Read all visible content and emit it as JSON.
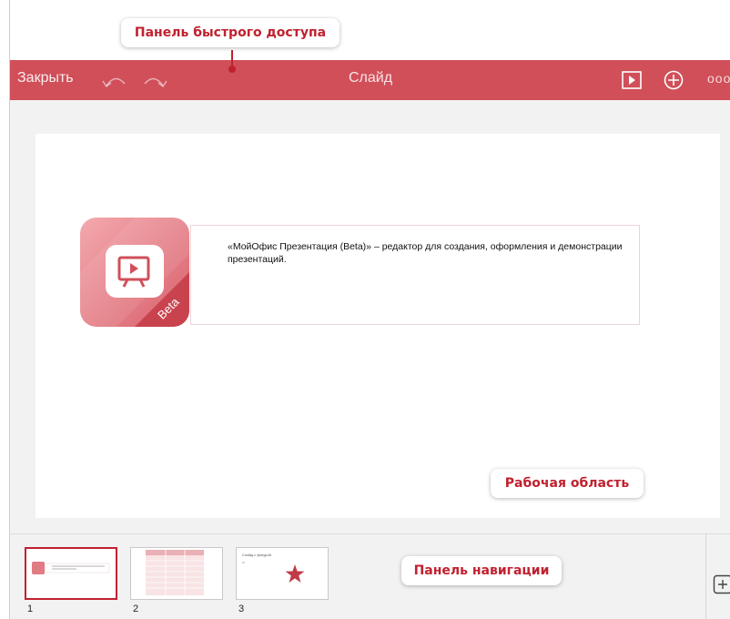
{
  "toolbar": {
    "close_label": "Закрыть",
    "title": "Слайд",
    "more_label": "ooo",
    "undo_icon": "undo-icon",
    "redo_icon": "redo-icon",
    "play_icon": "play-icon",
    "add_icon": "plus-circle-icon",
    "bg_color": "#d04f59"
  },
  "annotations": {
    "quick_access": "Панель быстрого доступа",
    "work_area": "Рабочая область",
    "navigation": "Панель навигации",
    "color": "#c0212f"
  },
  "slide": {
    "text": "«МойОфис Презентация (Beta)»  – редактор для создания, оформления и демонстрации презентаций.",
    "logo_badge": "Beta"
  },
  "navigation": {
    "thumbnails": [
      {
        "number": "1",
        "selected": true
      },
      {
        "number": "2",
        "selected": false
      },
      {
        "number": "3",
        "selected": false
      }
    ],
    "thumb3_title": "Слайд с фигурой",
    "add_icon": "plus-square-icon"
  }
}
